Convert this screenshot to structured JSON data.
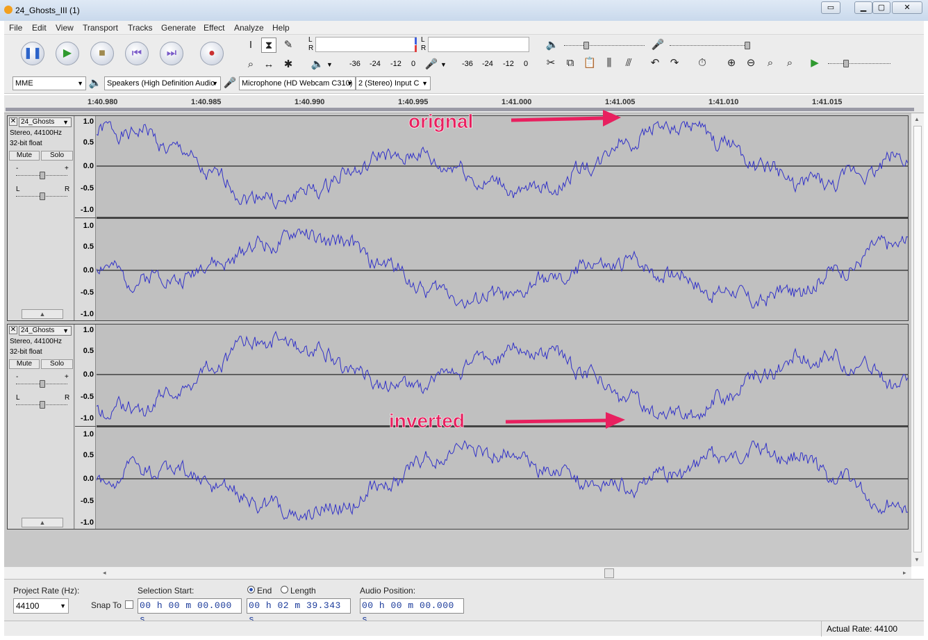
{
  "window": {
    "title": "24_Ghosts_III (1)"
  },
  "menu": [
    "File",
    "Edit",
    "View",
    "Transport",
    "Tracks",
    "Generate",
    "Effect",
    "Analyze",
    "Help"
  ],
  "meters": {
    "l": "L",
    "r": "R",
    "scale": [
      "-36",
      "-24",
      "-12",
      "0"
    ]
  },
  "devices": {
    "host": "MME",
    "output": "Speakers (High Definition Audio",
    "input": "Microphone (HD Webcam C310)",
    "channels": "2 (Stereo) Input C"
  },
  "timeline": {
    "ticks": [
      "1:40.980",
      "1:40.985",
      "1:40.990",
      "1:40.995",
      "1:41.000",
      "1:41.005",
      "1:41.010",
      "1:41.015"
    ]
  },
  "tracks": [
    {
      "name": "24_Ghosts",
      "format": "Stereo, 44100Hz",
      "depth": "32-bit float",
      "mute": "Mute",
      "solo": "Solo",
      "gain_minus": "-",
      "gain_plus": "+",
      "pan_l": "L",
      "pan_r": "R"
    },
    {
      "name": "24_Ghosts",
      "format": "Stereo, 44100Hz",
      "depth": "32-bit float",
      "mute": "Mute",
      "solo": "Solo",
      "gain_minus": "-",
      "gain_plus": "+",
      "pan_l": "L",
      "pan_r": "R"
    }
  ],
  "scale_labels": [
    "1.0",
    "0.5",
    "0.0",
    "-0.5",
    "-1.0"
  ],
  "annotations": {
    "top": "orignal",
    "bottom": "inverted",
    "color": "#e8205f"
  },
  "selection": {
    "rate_label": "Project Rate (Hz):",
    "rate_value": "44100",
    "snap_label": "Snap To",
    "start_label": "Selection Start:",
    "end_label": "End",
    "length_label": "Length",
    "start_value": "00 h 00 m 00.000 s",
    "end_value": "00 h 02 m 39.343 s",
    "position_label": "Audio Position:",
    "position_value": "00 h 00 m 00.000 s"
  },
  "status": {
    "actual_rate": "Actual Rate: 44100"
  },
  "colors": {
    "wave": "#3232c8",
    "track_bg": "#c0c0c0"
  }
}
